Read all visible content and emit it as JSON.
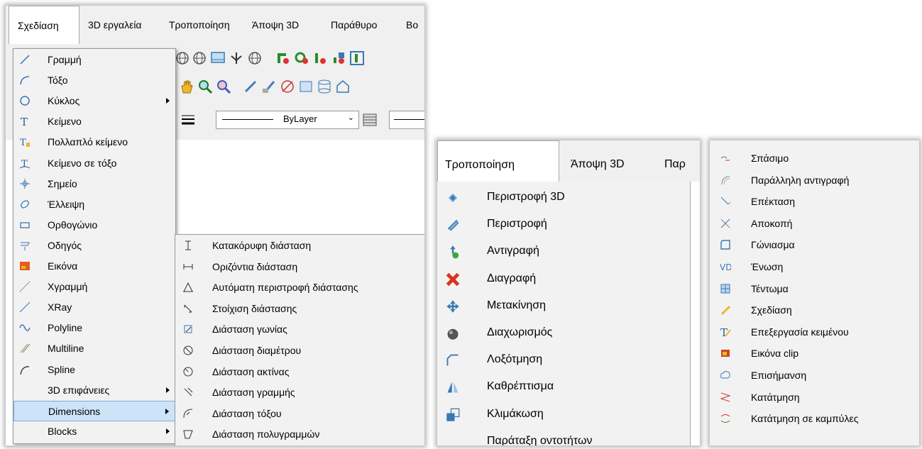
{
  "panel1": {
    "menubar": [
      "Σχεδίαση",
      "3D εργαλεία",
      "Τροποποίηση",
      "Άποψη 3D",
      "Παράθυρο",
      "Βο"
    ],
    "linetype_label": "ByLayer",
    "menu": [
      {
        "label": "Γραμμή",
        "icon": "line-icon"
      },
      {
        "label": "Τόξο",
        "icon": "arc-icon"
      },
      {
        "label": "Κύκλος",
        "icon": "circle-icon",
        "submenu": true
      },
      {
        "label": "Κείμενο",
        "icon": "text-icon"
      },
      {
        "label": "Πολλαπλό κείμενο",
        "icon": "multiline-text-icon"
      },
      {
        "label": "Κείμενο σε τόξο",
        "icon": "text-on-arc-icon"
      },
      {
        "label": "Σημείο",
        "icon": "point-icon"
      },
      {
        "label": "Έλλειψη",
        "icon": "ellipse-icon"
      },
      {
        "label": "Ορθογώνιο",
        "icon": "rectangle-icon"
      },
      {
        "label": "Οδηγός",
        "icon": "leader-icon"
      },
      {
        "label": "Εικόνα",
        "icon": "image-icon"
      },
      {
        "label": "Χγραμμή",
        "icon": "xline-icon"
      },
      {
        "label": "XRay",
        "icon": "xray-icon"
      },
      {
        "label": "Polyline",
        "icon": "polyline-icon"
      },
      {
        "label": "Multiline",
        "icon": "multiline-icon"
      },
      {
        "label": "Spline",
        "icon": "spline-icon"
      },
      {
        "label": "3D επιφάνειες",
        "icon": "",
        "submenu": true
      },
      {
        "label": "Dimensions",
        "icon": "",
        "submenu": true,
        "highlighted": true
      },
      {
        "label": "Blocks",
        "icon": "",
        "submenu": true
      }
    ],
    "submenu": [
      {
        "label": "Κατακόρυφη διάσταση",
        "icon": "vertical-dimension-icon"
      },
      {
        "label": "Οριζόντια διάσταση",
        "icon": "horizontal-dimension-icon"
      },
      {
        "label": "Αυτόματη περιστροφή διάστασης",
        "icon": "auto-rotate-dimension-icon"
      },
      {
        "label": "Στοίχιση διάστασης",
        "icon": "aligned-dimension-icon"
      },
      {
        "label": "Διάσταση γωνίας",
        "icon": "angular-dimension-icon"
      },
      {
        "label": "Διάσταση διαμέτρου",
        "icon": "diameter-dimension-icon"
      },
      {
        "label": "Διάσταση ακτίνας",
        "icon": "radius-dimension-icon"
      },
      {
        "label": "Διάσταση γραμμής",
        "icon": "line-dimension-icon"
      },
      {
        "label": "Διάσταση τόξου",
        "icon": "arc-dimension-icon"
      },
      {
        "label": "Διάσταση πολυγραμμών",
        "icon": "polyline-dimension-icon"
      }
    ]
  },
  "panel2": {
    "menubar": [
      "Τροποποίηση",
      "Άποψη 3D",
      "Παρ"
    ],
    "menu": [
      {
        "label": "Περιστροφή 3D",
        "icon": "rotate-3d-icon"
      },
      {
        "label": "Περιστροφή",
        "icon": "rotate-icon"
      },
      {
        "label": "Αντιγραφή",
        "icon": "copy-icon"
      },
      {
        "label": "Διαγραφή",
        "icon": "delete-icon"
      },
      {
        "label": "Μετακίνηση",
        "icon": "move-icon"
      },
      {
        "label": "Διαχωρισμός",
        "icon": "explode-icon"
      },
      {
        "label": "Λοξότμηση",
        "icon": "chamfer-icon"
      },
      {
        "label": "Καθρέπτισμα",
        "icon": "mirror-icon"
      },
      {
        "label": "Κλιμάκωση",
        "icon": "scale-icon"
      },
      {
        "label": "Παράταξη οντοτήτων",
        "icon": ""
      }
    ]
  },
  "panel3": {
    "menu": [
      {
        "label": "Σπάσιμο",
        "icon": "break-icon"
      },
      {
        "label": "Παράλληλη αντιγραφή",
        "icon": "offset-icon"
      },
      {
        "label": "Επέκταση",
        "icon": "extend-icon"
      },
      {
        "label": "Αποκοπή",
        "icon": "trim-icon"
      },
      {
        "label": "Γώνιασμα",
        "icon": "fillet-icon"
      },
      {
        "label": "Ένωση",
        "icon": "join-icon"
      },
      {
        "label": "Τέντωμα",
        "icon": "stretch-icon"
      },
      {
        "label": "Σχεδίαση",
        "icon": "draw-icon"
      },
      {
        "label": "Επεξεργασία κειμένου",
        "icon": "edit-text-icon"
      },
      {
        "label": "Εικόνα clip",
        "icon": "image-clip-icon"
      },
      {
        "label": "Επισήμανση",
        "icon": "revision-cloud-icon"
      },
      {
        "label": "Κατάτμηση",
        "icon": "divide-icon"
      },
      {
        "label": "Κατάτμηση σε καμπύλες",
        "icon": "divide-curves-icon"
      }
    ]
  }
}
